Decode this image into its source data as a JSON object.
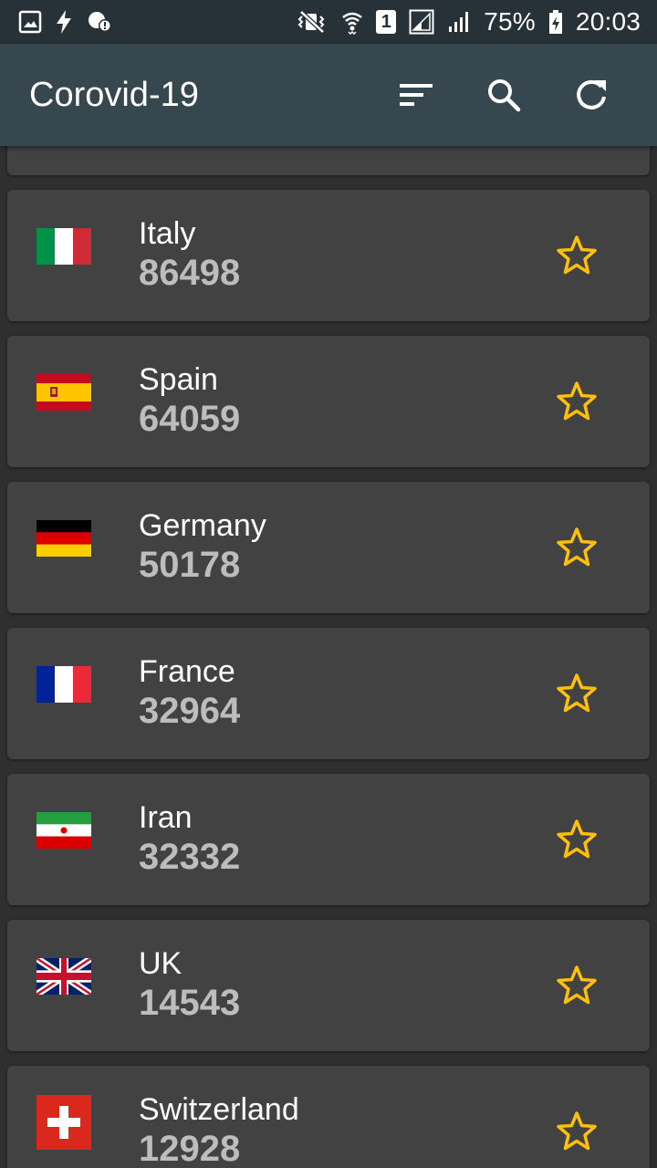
{
  "status_bar": {
    "battery": "75%",
    "time": "20:03",
    "sim": "1"
  },
  "app_bar": {
    "title": "Corovid-19"
  },
  "colors": {
    "star": "#ffc107",
    "app_bar": "#37474f",
    "status_bar": "#263238",
    "card": "#424242"
  },
  "countries": [
    {
      "name": "Italy",
      "count": "86498",
      "flag": "italy-flag-icon"
    },
    {
      "name": "Spain",
      "count": "64059",
      "flag": "spain-flag-icon"
    },
    {
      "name": "Germany",
      "count": "50178",
      "flag": "germany-flag-icon"
    },
    {
      "name": "France",
      "count": "32964",
      "flag": "france-flag-icon"
    },
    {
      "name": "Iran",
      "count": "32332",
      "flag": "iran-flag-icon"
    },
    {
      "name": "UK",
      "count": "14543",
      "flag": "uk-flag-icon"
    },
    {
      "name": "Switzerland",
      "count": "12928",
      "flag": "switzerland-flag-icon"
    }
  ]
}
